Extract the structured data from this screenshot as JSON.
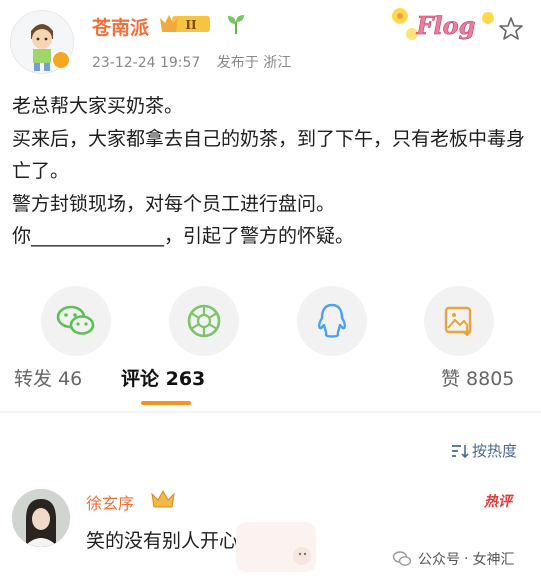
{
  "post": {
    "author": "苍南派",
    "vip_badge": "II",
    "timestamp": "23-12-24 19:57",
    "location": "发布于 浙江",
    "decoration": "Flog",
    "lines": [
      "老总帮大家买奶茶。",
      "买来后，大家都拿去自己的奶茶，到了下午，只有老板中毒身亡了。",
      "警方封锁现场，对每个员工进行盘问。",
      "你______________，引起了警方的怀疑。"
    ]
  },
  "share_icons": [
    "wechat-icon",
    "moments-icon",
    "qq-icon",
    "album-icon"
  ],
  "tabs": {
    "repost": "转发 46",
    "comments": "评论 263",
    "likes": "赞 8805"
  },
  "sort_label": "按热度",
  "comment": {
    "user": "徐玄序",
    "badge": "热评",
    "text": "笑的没有别人开心"
  },
  "watermark": {
    "label": "公众号",
    "separator": "·",
    "name": "女神汇"
  },
  "colors": {
    "username": "#f36f3a",
    "accent": "#f7941d",
    "wechat": "#5fbf57",
    "moments": "#7cc467",
    "qq": "#4c9ff2",
    "album": "#e8a53a",
    "hot": "#e43a3a",
    "link": "#4a6a93"
  }
}
